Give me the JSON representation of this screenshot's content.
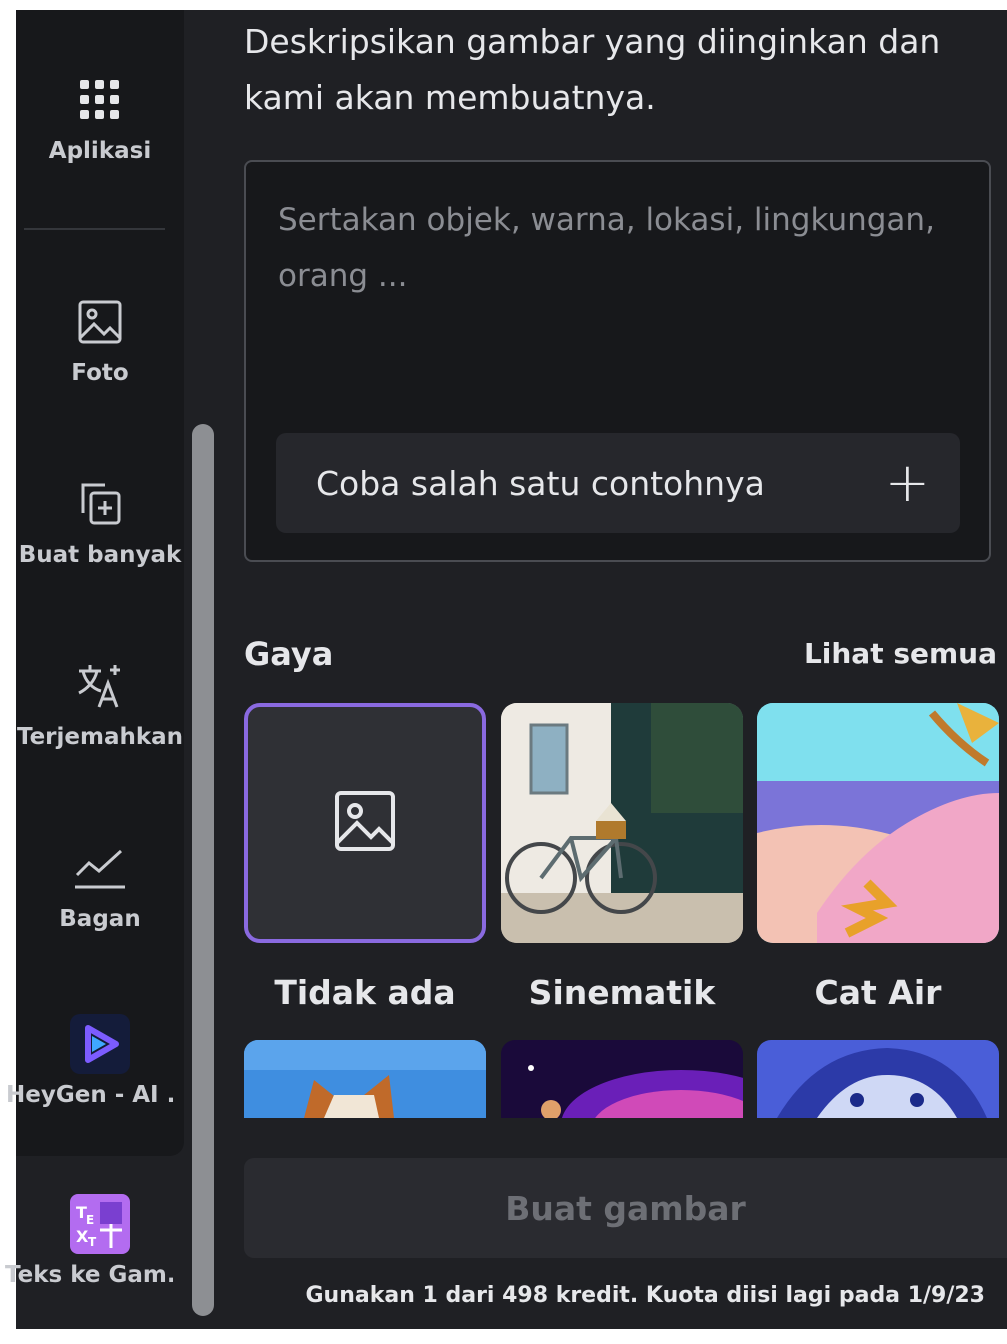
{
  "sidebar": {
    "items": [
      {
        "label": "Aplikasi",
        "icon": "grid-icon"
      },
      {
        "label": "Foto",
        "icon": "image-icon"
      },
      {
        "label": "Buat banyak",
        "icon": "duplicate-add-icon"
      },
      {
        "label": "Terjemahkan",
        "icon": "translate-icon"
      },
      {
        "label": "Bagan",
        "icon": "chart-line-icon"
      },
      {
        "label": "HeyGen - AI ...",
        "icon": "heygen-logo-icon"
      },
      {
        "label": "Teks ke Gam...",
        "icon": "text-to-image-app-icon"
      }
    ]
  },
  "main": {
    "headline": "Deskripsikan gambar yang diinginkan dan kami akan membuatnya.",
    "prompt": {
      "placeholder": "Sertakan objek, warna, lokasi, lingkungan, orang ...",
      "value": ""
    },
    "example_button": "Coba salah satu contohnya",
    "style_section": {
      "title": "Gaya",
      "see_all": "Lihat semua",
      "styles": [
        {
          "label": "Tidak ada",
          "selected": true
        },
        {
          "label": "Sinematik",
          "selected": false
        },
        {
          "label": "Cat Air",
          "selected": false
        }
      ]
    },
    "create_button": "Buat gambar",
    "credit_note": "Gunakan 1 dari 498 kredit. Kuota diisi lagi pada 1/9/23"
  },
  "colors": {
    "background": "#1f2024",
    "sidebar": "#17181b",
    "accent_selected": "#8a6ae0",
    "text": "#e6e7ea",
    "disabled_text": "#6d6f75"
  }
}
